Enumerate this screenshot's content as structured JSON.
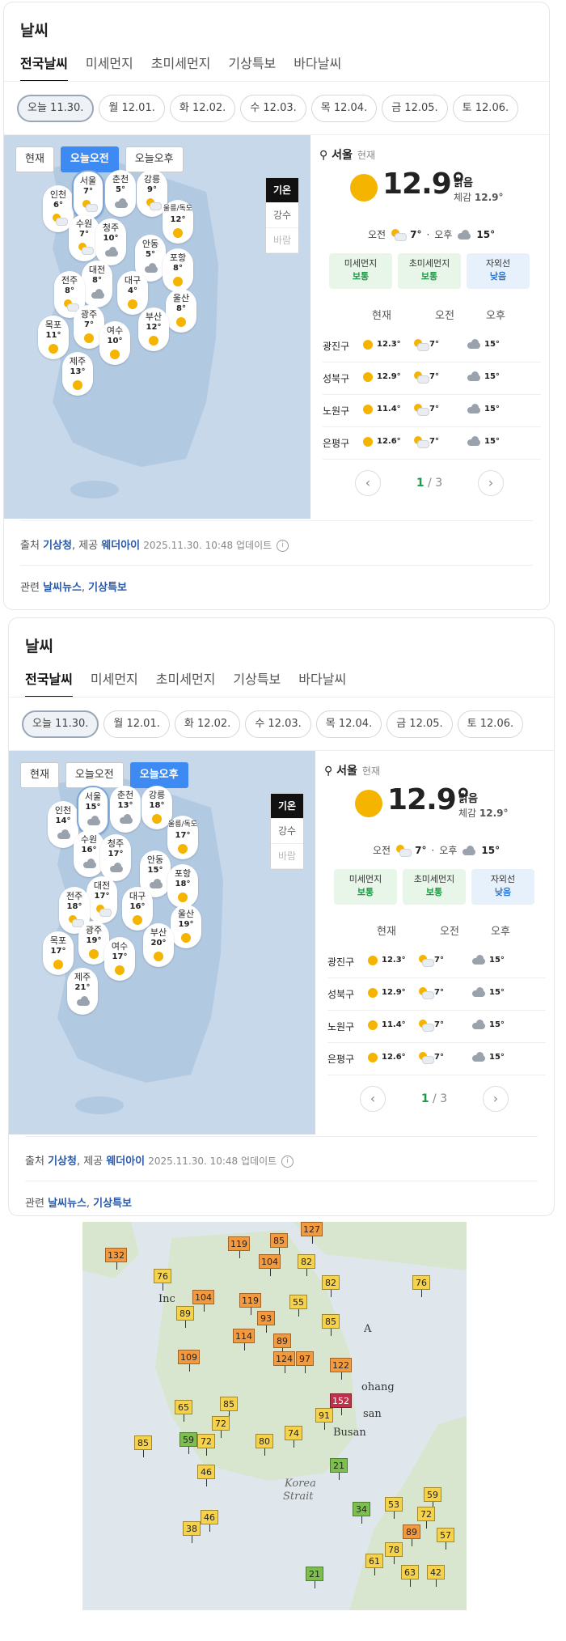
{
  "panels": [
    {
      "title": "날씨",
      "tabs": [
        "전국날씨",
        "미세먼지",
        "초미세먼지",
        "기상특보",
        "바다날씨"
      ],
      "days": [
        "오늘 11.30.",
        "월 12.01.",
        "화 12.02.",
        "수 12.03.",
        "목 12.04.",
        "금 12.05.",
        "토 12.06."
      ],
      "modes": [
        "현재",
        "오늘오전",
        "오늘오후"
      ],
      "active_mode": 1,
      "side": [
        "기온",
        "강수",
        "바람"
      ],
      "cities": [
        {
          "name": "인천",
          "temp": "6°"
        },
        {
          "name": "서울",
          "temp": "7°"
        },
        {
          "name": "춘천",
          "temp": "5°"
        },
        {
          "name": "강릉",
          "temp": "9°"
        },
        {
          "name": "울릉/독도",
          "temp": "12°"
        },
        {
          "name": "수원",
          "temp": "7°"
        },
        {
          "name": "청주",
          "temp": "10°"
        },
        {
          "name": "안동",
          "temp": "5°"
        },
        {
          "name": "대전",
          "temp": "8°"
        },
        {
          "name": "포항",
          "temp": "8°"
        },
        {
          "name": "전주",
          "temp": "8°"
        },
        {
          "name": "대구",
          "temp": "4°"
        },
        {
          "name": "울산",
          "temp": "8°"
        },
        {
          "name": "광주",
          "temp": "7°"
        },
        {
          "name": "목포",
          "temp": "11°"
        },
        {
          "name": "여수",
          "temp": "10°"
        },
        {
          "name": "부산",
          "temp": "12°"
        },
        {
          "name": "제주",
          "temp": "13°"
        }
      ]
    },
    {
      "title": "날씨",
      "tabs": [
        "전국날씨",
        "미세먼지",
        "초미세먼지",
        "기상특보",
        "바다날씨"
      ],
      "days": [
        "오늘 11.30.",
        "월 12.01.",
        "화 12.02.",
        "수 12.03.",
        "목 12.04.",
        "금 12.05.",
        "토 12.06."
      ],
      "modes": [
        "현재",
        "오늘오전",
        "오늘오후"
      ],
      "active_mode": 2,
      "side": [
        "기온",
        "강수",
        "바람"
      ],
      "cities": [
        {
          "name": "인천",
          "temp": "14°"
        },
        {
          "name": "서울",
          "temp": "15°"
        },
        {
          "name": "춘천",
          "temp": "13°"
        },
        {
          "name": "강릉",
          "temp": "18°"
        },
        {
          "name": "울릉/독도",
          "temp": "17°"
        },
        {
          "name": "수원",
          "temp": "16°"
        },
        {
          "name": "청주",
          "temp": "17°"
        },
        {
          "name": "안동",
          "temp": "15°"
        },
        {
          "name": "대전",
          "temp": "17°"
        },
        {
          "name": "포항",
          "temp": "18°"
        },
        {
          "name": "전주",
          "temp": "18°"
        },
        {
          "name": "대구",
          "temp": "16°"
        },
        {
          "name": "울산",
          "temp": "19°"
        },
        {
          "name": "광주",
          "temp": "19°"
        },
        {
          "name": "목포",
          "temp": "17°"
        },
        {
          "name": "여수",
          "temp": "17°"
        },
        {
          "name": "부산",
          "temp": "20°"
        },
        {
          "name": "제주",
          "temp": "21°"
        }
      ]
    }
  ],
  "current": {
    "location": "서울",
    "now_label": "현재",
    "temp": "12.9°",
    "condition": "맑음",
    "feels_label": "체감",
    "feels": "12.9°",
    "am_label": "오전",
    "am_temp": "7°",
    "pm_label": "오후",
    "pm_temp": "15°",
    "chips": [
      {
        "label": "미세먼지",
        "value": "보통"
      },
      {
        "label": "초미세먼지",
        "value": "보통"
      },
      {
        "label": "자외선",
        "value": "낮음"
      }
    ],
    "table_headers": [
      "현재",
      "오전",
      "오후"
    ],
    "rows": [
      {
        "name": "광진구",
        "now": "12.3°",
        "am": "7°",
        "pm": "15°"
      },
      {
        "name": "성북구",
        "now": "12.9°",
        "am": "7°",
        "pm": "15°"
      },
      {
        "name": "노원구",
        "now": "11.4°",
        "am": "7°",
        "pm": "15°"
      },
      {
        "name": "은평구",
        "now": "12.6°",
        "am": "7°",
        "pm": "15°"
      }
    ],
    "page": "1",
    "pages": "3"
  },
  "footer": {
    "source_label": "출처",
    "source": "기상청",
    "provide_label": "제공",
    "provider": "웨더아이",
    "updated": "2025.11.30. 10:48 업데이트",
    "related_label": "관련",
    "related1": "날씨뉴스",
    "related2": "기상특보"
  },
  "aq_map": {
    "labels": [
      "Inc",
      "A",
      "ohang",
      "san",
      "Busan",
      "Korea",
      "Strait"
    ],
    "values": [
      "132",
      "76",
      "76",
      "127",
      "119",
      "85",
      "104",
      "82",
      "104",
      "55",
      "82",
      "89",
      "119",
      "85",
      "109",
      "114",
      "93",
      "89",
      "124",
      "122",
      "152",
      "91",
      "65",
      "85",
      "72",
      "59",
      "85",
      "80",
      "74",
      "72",
      "46",
      "21",
      "34",
      "53",
      "59",
      "72",
      "89",
      "57",
      "46",
      "38",
      "21",
      "63",
      "42",
      "78",
      "61",
      "97"
    ]
  },
  "colors": {
    "accent": "#3d8bf2",
    "sun": "#f4b400",
    "good": "#1d9b45",
    "uv": "#2a77d4",
    "link": "#2a5aa8"
  }
}
